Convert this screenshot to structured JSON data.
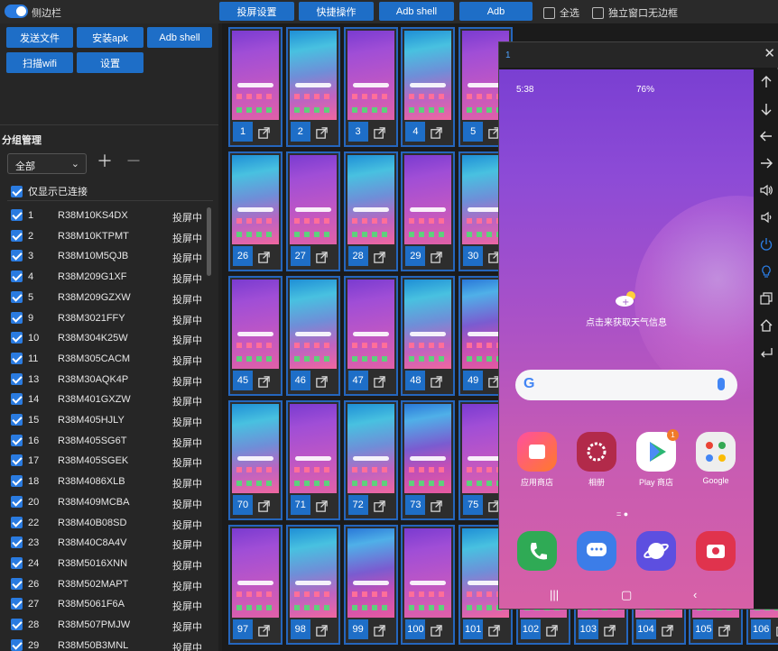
{
  "topbar": {
    "sidebar_toggle_label": "侧边栏",
    "buttons": [
      "投屏设置",
      "快捷操作",
      "Adb shell",
      "Adb"
    ],
    "select_all_label": "全选",
    "borderless_label": "独立窗口无边框"
  },
  "left_panel": {
    "buttons": [
      "发送文件",
      "安装apk",
      "Adb shell",
      "扫描wifi",
      "设置"
    ],
    "group_title": "分组管理",
    "group_select": "全部",
    "only_connected_label": "仅显示已连接",
    "devices": [
      {
        "idx": "1",
        "serial": "R38M10KS4DX",
        "status": "投屏中"
      },
      {
        "idx": "2",
        "serial": "R38M10KTPMT",
        "status": "投屏中"
      },
      {
        "idx": "3",
        "serial": "R38M10M5QJB",
        "status": "投屏中"
      },
      {
        "idx": "4",
        "serial": "R38M209G1XF",
        "status": "投屏中"
      },
      {
        "idx": "5",
        "serial": "R38M209GZXW",
        "status": "投屏中"
      },
      {
        "idx": "9",
        "serial": "R38M3021FFY",
        "status": "投屏中"
      },
      {
        "idx": "10",
        "serial": "R38M304K25W",
        "status": "投屏中"
      },
      {
        "idx": "11",
        "serial": "R38M305CACM",
        "status": "投屏中"
      },
      {
        "idx": "13",
        "serial": "R38M30AQK4P",
        "status": "投屏中"
      },
      {
        "idx": "14",
        "serial": "R38M401GXZW",
        "status": "投屏中"
      },
      {
        "idx": "15",
        "serial": "R38M405HJLY",
        "status": "投屏中"
      },
      {
        "idx": "16",
        "serial": "R38M405SG6T",
        "status": "投屏中"
      },
      {
        "idx": "17",
        "serial": "R38M405SGEK",
        "status": "投屏中"
      },
      {
        "idx": "18",
        "serial": "R38M4086XLB",
        "status": "投屏中"
      },
      {
        "idx": "20",
        "serial": "R38M409MCBA",
        "status": "投屏中"
      },
      {
        "idx": "22",
        "serial": "R38M40B08SD",
        "status": "投屏中"
      },
      {
        "idx": "23",
        "serial": "R38M40C8A4V",
        "status": "投屏中"
      },
      {
        "idx": "24",
        "serial": "R38M5016XNN",
        "status": "投屏中"
      },
      {
        "idx": "26",
        "serial": "R38M502MAPT",
        "status": "投屏中"
      },
      {
        "idx": "27",
        "serial": "R38M5061F6A",
        "status": "投屏中"
      },
      {
        "idx": "28",
        "serial": "R38M507PMJW",
        "status": "投屏中"
      },
      {
        "idx": "29",
        "serial": "R38M50B3MNL",
        "status": "投屏中"
      }
    ]
  },
  "grid": {
    "rows": [
      [
        "1",
        "2",
        "3",
        "4",
        "5"
      ],
      [
        "26",
        "27",
        "28",
        "29",
        "30"
      ],
      [
        "45",
        "46",
        "47",
        "48",
        "49"
      ],
      [
        "70",
        "71",
        "72",
        "73",
        "75"
      ],
      [
        "97",
        "98",
        "99",
        "100",
        "101",
        "102",
        "103",
        "104",
        "105",
        "106"
      ]
    ]
  },
  "phone_window": {
    "title": "1",
    "status_time": "5:38",
    "status_battery": "76%",
    "weather_text": "点击来获取天气信息",
    "search_logo": "G",
    "apps_row1": [
      "应用商店",
      "相册",
      "Play 商店",
      "Google"
    ],
    "badge_count": "1"
  },
  "colors": {
    "accent": "#1e6ec7",
    "tile_border": "#2566bd",
    "background": "#1f1f1f"
  }
}
